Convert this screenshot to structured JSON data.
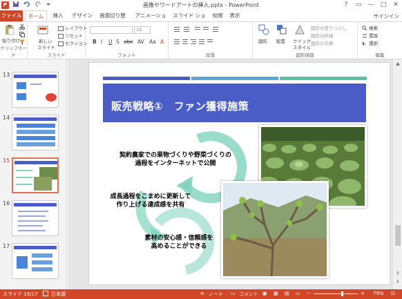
{
  "window": {
    "title": "画像やワードアートの挿入.pptx - PowerPoint",
    "app_icon": "P",
    "controls": [
      "?",
      "▭",
      "—",
      "□",
      "✕"
    ]
  },
  "qat": [
    "save-icon",
    "undo-icon",
    "redo-icon",
    "customize-icon"
  ],
  "tabs": [
    {
      "label": "ファイル"
    },
    {
      "label": "ホーム"
    },
    {
      "label": "挿入"
    },
    {
      "label": "デザイン"
    },
    {
      "label": "画面切り替え"
    },
    {
      "label": "アニメーション"
    },
    {
      "label": "スライド ショー"
    },
    {
      "label": "校閲"
    },
    {
      "label": "表示"
    }
  ],
  "signin": "サインイン",
  "ribbon": {
    "clipboard": {
      "label": "クリップボード",
      "paste": "貼り付け"
    },
    "slides": {
      "label": "スライド",
      "new_slide_line1": "新しい",
      "new_slide_line2": "スライド",
      "layout": "レイアウト",
      "reset": "リセット",
      "section": "セクション"
    },
    "font": {
      "label": "フォント",
      "font_size": "18",
      "buttons": [
        "B",
        "I",
        "U",
        "S",
        "abc",
        "AV",
        "Aa",
        "A"
      ]
    },
    "paragraph": {
      "label": "段落"
    },
    "drawing": {
      "label": "図形描画",
      "shapes": "図形",
      "arrange": "配置",
      "quick_style_line1": "クイック",
      "quick_style_line2": "スタイル",
      "fill": "図形の塗りつぶし",
      "outline": "図形の枠線",
      "effects": "図形の効果"
    },
    "editing": {
      "label": "編集",
      "find": "検索",
      "replace": "置換",
      "select": "選択"
    }
  },
  "thumbnails": [
    {
      "num": "13",
      "selected": false
    },
    {
      "num": "14",
      "selected": false
    },
    {
      "num": "15",
      "selected": true
    },
    {
      "num": "16",
      "selected": false
    },
    {
      "num": "17",
      "selected": false
    }
  ],
  "slide": {
    "title": "販売戦略①　ファン獲得施策",
    "step1_line1": "契約農家での果物づくりや野菜づくりの",
    "step1_line2": "過程をインターネットで公開",
    "step2_line1": "成長過程をこまめに更新して",
    "step2_line2": "作り上げる達成感を共有",
    "step3_line1": "素材の安心感・信頼感を",
    "step3_line2": "高めることができる",
    "colors": {
      "banner": "#4a5cc6",
      "stripe_dark": "#4a5cc6",
      "stripe_light": "#5ba4dc",
      "stripe_green": "#5cc0a4",
      "arrow": "#7fd3bf"
    }
  },
  "status": {
    "slide_info": "スライド 15/17",
    "language": "日本語",
    "notes": "ノート",
    "comments": "コメント",
    "zoom": "79%"
  }
}
